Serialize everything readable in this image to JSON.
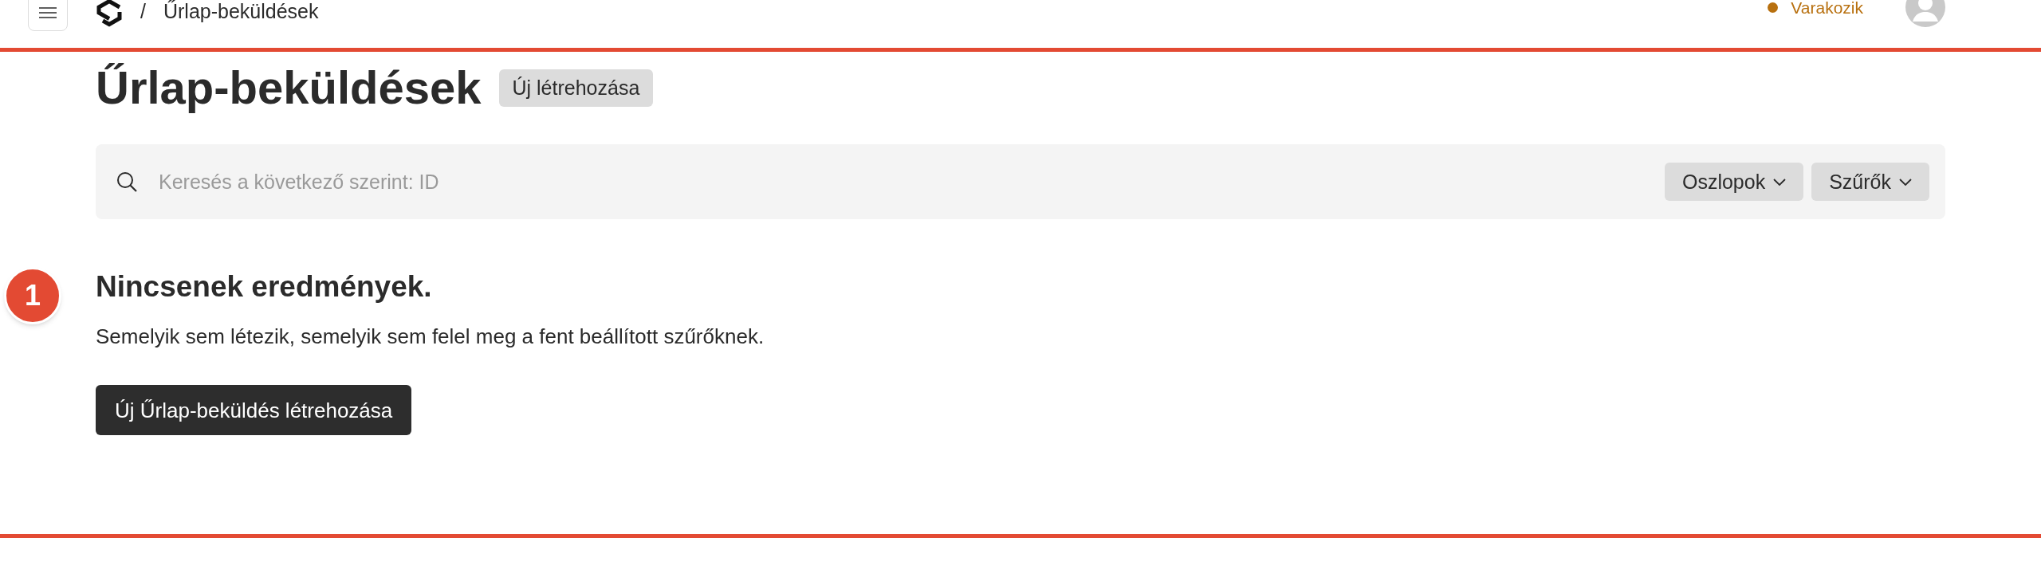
{
  "header": {
    "breadcrumb_separator": "/",
    "breadcrumb": "Űrlap-beküldések",
    "status": "Varakozik"
  },
  "page": {
    "title": "Űrlap-beküldések",
    "create_button": "Új létrehozása"
  },
  "search": {
    "placeholder": "Keresés a következő szerint: ID",
    "buttons": [
      "Oszlopok",
      "Szűrők"
    ]
  },
  "empty_state": {
    "heading": "Nincsenek eredmények.",
    "message": "Semelyik sem létezik, semelyik sem felel meg a fent beállított szűrőknek.",
    "button": "Új Űrlap-beküldés létrehozása"
  },
  "annotation": {
    "marker": "1"
  }
}
